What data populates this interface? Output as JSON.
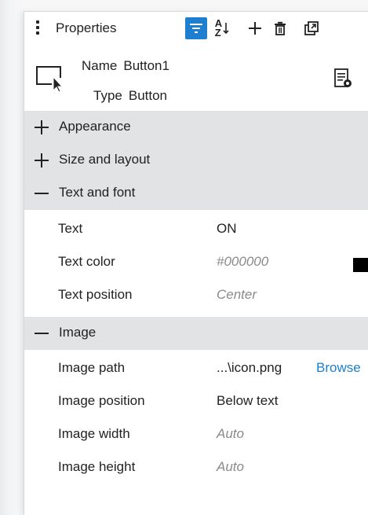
{
  "toolbar": {
    "title": "Properties",
    "icons": [
      "more-vertical-icon",
      "filter-icon",
      "sort-az-icon",
      "add-icon",
      "trash-icon",
      "popout-icon"
    ],
    "sort_az_top": "A",
    "sort_az_bottom": "Z",
    "active_color": "#1e7fd0"
  },
  "object": {
    "name_label": "Name",
    "name_value": "Button1",
    "type_label": "Type",
    "type_value": "Button"
  },
  "sections": {
    "appearance": {
      "label": "Appearance",
      "state": "collapsed"
    },
    "size_layout": {
      "label": "Size and layout",
      "state": "collapsed"
    },
    "text_font": {
      "label": "Text and font",
      "state": "expanded",
      "rows": [
        {
          "label": "Text",
          "value": "ON"
        },
        {
          "label": "Text color",
          "value": "#000000",
          "swatch": "#000000"
        },
        {
          "label": "Text position",
          "value": "Center"
        }
      ]
    },
    "image": {
      "label": "Image",
      "state": "expanded",
      "rows": [
        {
          "label": "Image path",
          "value": "...\\icon.png",
          "action": "Browse"
        },
        {
          "label": "Image position",
          "value": "Below text"
        },
        {
          "label": "Image width",
          "value": "Auto"
        },
        {
          "label": "Image height",
          "value": "Auto"
        }
      ]
    }
  },
  "colors": {
    "section_bg": "#e2e3e5",
    "link": "#1e7fd0",
    "muted_text": "#8a8a8a"
  }
}
